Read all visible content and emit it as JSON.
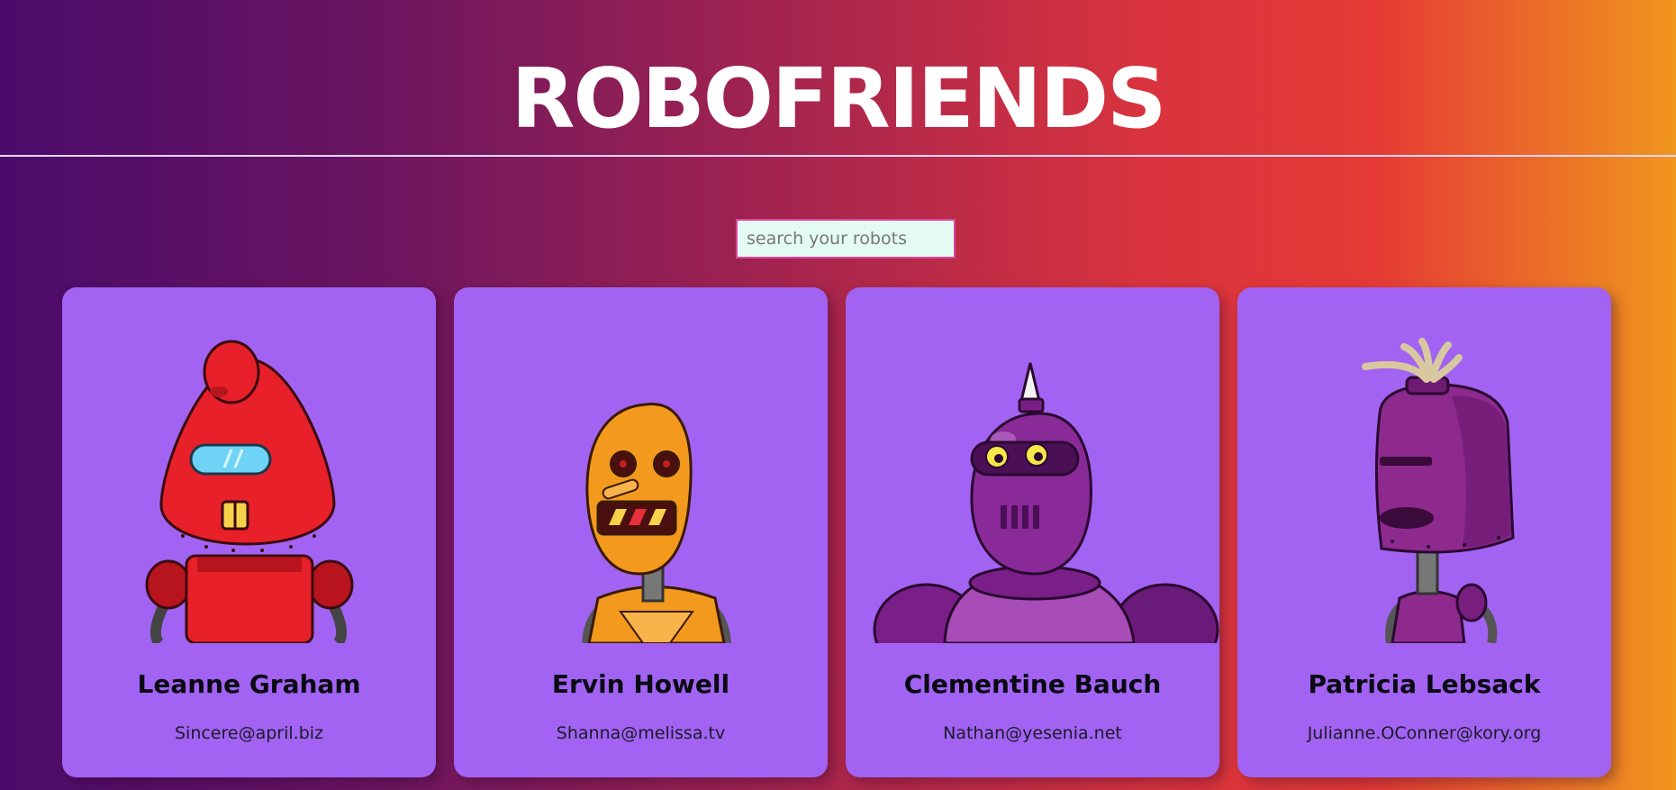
{
  "header": {
    "title": "ROBOFRIENDS"
  },
  "search": {
    "placeholder": "search your robots",
    "value": ""
  },
  "robots": [
    {
      "name": "Leanne Graham",
      "email": "Sincere@april.biz",
      "color": "#e8202a"
    },
    {
      "name": "Ervin Howell",
      "email": "Shanna@melissa.tv",
      "color": "#f39a1e"
    },
    {
      "name": "Clementine Bauch",
      "email": "Nathan@yesenia.net",
      "color": "#8a2a98"
    },
    {
      "name": "Patricia Lebsack",
      "email": "Julianne.OConner@kory.org",
      "color": "#8e2a8e"
    }
  ],
  "colors": {
    "card_background": "#a263f2",
    "search_background": "#e4fbf4",
    "search_border": "#d9489c"
  }
}
